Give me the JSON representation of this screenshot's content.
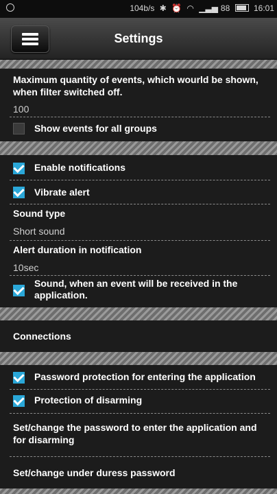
{
  "status_bar": {
    "speed": "104b/s",
    "icons": [
      "bluetooth-icon",
      "alarm-icon",
      "wifi-icon",
      "signal-icon"
    ],
    "signal": "88",
    "time": "16:01"
  },
  "header": {
    "title": "Settings",
    "menu_icon": "hamburger-menu-icon"
  },
  "events": {
    "max_label": "Maximum quantity of events, which wourld be shown, when filter switched off.",
    "max_value": "100",
    "show_all_groups": {
      "label": "Show events for all groups",
      "checked": false
    }
  },
  "notifications": {
    "enable": {
      "label": "Enable notifications",
      "checked": true
    },
    "vibrate": {
      "label": "Vibrate alert",
      "checked": true
    },
    "sound_type_label": "Sound type",
    "sound_type_value": "Short sound",
    "alert_duration_label": "Alert duration in notification",
    "alert_duration_value": "10sec",
    "sound_in_app": {
      "label": "Sound, when an event will be received in the application.",
      "checked": true
    }
  },
  "connections": {
    "label": "Connections"
  },
  "security": {
    "password_protection": {
      "label": "Password protection for entering the application",
      "checked": true
    },
    "disarm_protection": {
      "label": "Protection of disarming",
      "checked": true
    },
    "set_password_label": "Set/change the password to enter the application and for disarming",
    "duress_password_label": "Set/change under duress password"
  },
  "colors": {
    "accent": "#2aa7d8",
    "background": "#1c1c1c"
  }
}
